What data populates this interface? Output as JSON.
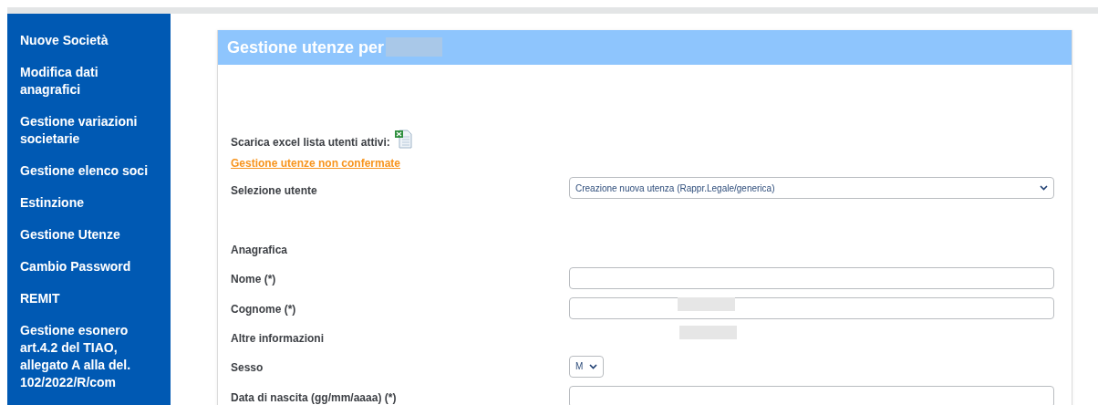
{
  "sidebar": {
    "items": [
      {
        "label": "Nuove Società"
      },
      {
        "label": "Modifica dati anagrafici"
      },
      {
        "label": "Gestione variazioni societarie"
      },
      {
        "label": "Gestione elenco soci"
      },
      {
        "label": "Estinzione"
      },
      {
        "label": "Gestione Utenze"
      },
      {
        "label": "Cambio Password"
      },
      {
        "label": "REMIT"
      },
      {
        "label": "Gestione esonero art.4.2 del TIAO, allegato A alla del. 102/2022/R/com"
      }
    ]
  },
  "panel": {
    "title": "Gestione utenze per",
    "download": {
      "label": "Scarica excel lista utenti attivi:"
    },
    "link": "Gestione utenze non confermate",
    "rows": [
      {
        "kind": "select",
        "label": "Selezione utente",
        "value": "Creazione nuova utenza (Rappr.Legale/generica)"
      },
      {
        "kind": "section",
        "label": "Anagrafica"
      },
      {
        "kind": "text",
        "label": "Nome (*)"
      },
      {
        "kind": "text",
        "label": "Cognome (*)"
      },
      {
        "kind": "section",
        "label": "Altre informazioni"
      },
      {
        "kind": "short-select",
        "label": "Sesso",
        "value": "M"
      },
      {
        "kind": "text",
        "label": "Data di nascita (gg/mm/aaaa) (*)"
      }
    ]
  }
}
